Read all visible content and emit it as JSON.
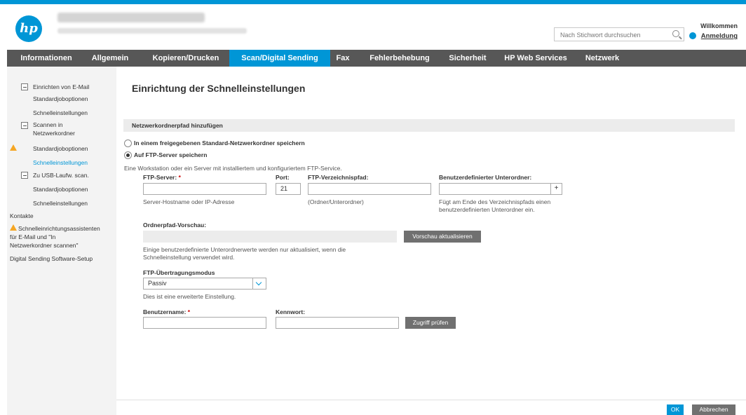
{
  "header": {
    "welcome": "Willkommen",
    "login": "Anmeldung",
    "search_placeholder": "Nach Stichwort durchsuchen"
  },
  "nav": [
    "Informationen",
    "Allgemein",
    "Kopieren/Drucken",
    "Scan/Digital Sending",
    "Fax",
    "Fehlerbehebung",
    "Sicherheit",
    "HP Web Services",
    "Netzwerk"
  ],
  "sidebar": {
    "email_setup": "Einrichten von E-Mail",
    "email_default": "Standardjoboptionen",
    "email_quick": "Schnelleinstellungen",
    "folder_line1": "Scannen in",
    "folder_line2": "Netzwerkordner",
    "folder_default": "Standardjoboptionen",
    "folder_quick": "Schnelleinstellungen",
    "usb": "Zu USB-Laufw. scan.",
    "usb_default": "Standardjoboptionen",
    "usb_quick": "Schnelleinstellungen",
    "contacts": "Kontakte",
    "wizard_line1": "Schnelleinrichtungsassistenten",
    "wizard_line2": "für E-Mail und \"In",
    "wizard_line3": "Netzwerkordner scannen\"",
    "dss": "Digital Sending Software-Setup"
  },
  "main": {
    "page_title": "Einrichtung der Schnelleinstellungen",
    "section_title": "Netzwerkordnerpfad hinzufügen",
    "radio_shared": "In einem freigegebenen Standard-Netzwerkordner speichern",
    "radio_ftp": "Auf FTP-Server speichern",
    "ftp_desc": "Eine Workstation oder ein Server mit installiertem und konfiguriertem FTP-Service.",
    "ftp_server_label": "FTP-Server:",
    "req_mark": "*",
    "port_label": "Port:",
    "port_value": "21",
    "ftp_path_label": "FTP-Verzeichnispfad:",
    "subfolder_label": "Benutzerdefinierter Unterordner:",
    "plus": "+",
    "server_hint": "Server-Hostname oder IP-Adresse",
    "path_hint": "(Ordner/Unterordner)",
    "subfolder_hint1": "Fügt am Ende des Verzeichnispfads einen",
    "subfolder_hint2": "benutzerdefinierten Unterordner ein.",
    "preview_label": "Ordnerpfad-Vorschau:",
    "preview_button": "Vorschau aktualisieren",
    "preview_note1": "Einige benutzerdefinierte Unterordnerwerte werden nur aktualisiert, wenn die",
    "preview_note2": "Schnelleinstellung verwendet wird.",
    "transfer_label": "FTP-Übertragungsmodus",
    "transfer_value": "Passiv",
    "transfer_note": "Dies ist eine erweiterte Einstellung.",
    "username_label": "Benutzername:",
    "password_label": "Kennwort:",
    "verify_button": "Zugriff prüfen"
  },
  "footer": {
    "ok": "OK",
    "cancel": "Abbrechen"
  },
  "colors": {
    "accent": "#0096d6",
    "nav_bg": "#575757",
    "warning": "#f5a623"
  }
}
